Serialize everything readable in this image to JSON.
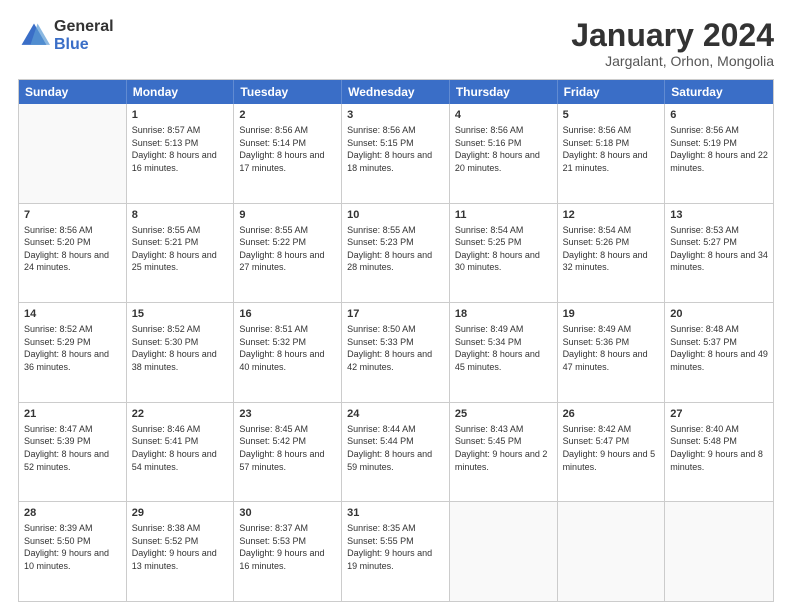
{
  "logo": {
    "general": "General",
    "blue": "Blue"
  },
  "title": "January 2024",
  "subtitle": "Jargalant, Orhon, Mongolia",
  "header_days": [
    "Sunday",
    "Monday",
    "Tuesday",
    "Wednesday",
    "Thursday",
    "Friday",
    "Saturday"
  ],
  "weeks": [
    [
      {
        "day": "",
        "empty": true
      },
      {
        "day": "1",
        "sunrise": "Sunrise: 8:57 AM",
        "sunset": "Sunset: 5:13 PM",
        "daylight": "Daylight: 8 hours and 16 minutes."
      },
      {
        "day": "2",
        "sunrise": "Sunrise: 8:56 AM",
        "sunset": "Sunset: 5:14 PM",
        "daylight": "Daylight: 8 hours and 17 minutes."
      },
      {
        "day": "3",
        "sunrise": "Sunrise: 8:56 AM",
        "sunset": "Sunset: 5:15 PM",
        "daylight": "Daylight: 8 hours and 18 minutes."
      },
      {
        "day": "4",
        "sunrise": "Sunrise: 8:56 AM",
        "sunset": "Sunset: 5:16 PM",
        "daylight": "Daylight: 8 hours and 20 minutes."
      },
      {
        "day": "5",
        "sunrise": "Sunrise: 8:56 AM",
        "sunset": "Sunset: 5:18 PM",
        "daylight": "Daylight: 8 hours and 21 minutes."
      },
      {
        "day": "6",
        "sunrise": "Sunrise: 8:56 AM",
        "sunset": "Sunset: 5:19 PM",
        "daylight": "Daylight: 8 hours and 22 minutes."
      }
    ],
    [
      {
        "day": "7",
        "sunrise": "Sunrise: 8:56 AM",
        "sunset": "Sunset: 5:20 PM",
        "daylight": "Daylight: 8 hours and 24 minutes."
      },
      {
        "day": "8",
        "sunrise": "Sunrise: 8:55 AM",
        "sunset": "Sunset: 5:21 PM",
        "daylight": "Daylight: 8 hours and 25 minutes."
      },
      {
        "day": "9",
        "sunrise": "Sunrise: 8:55 AM",
        "sunset": "Sunset: 5:22 PM",
        "daylight": "Daylight: 8 hours and 27 minutes."
      },
      {
        "day": "10",
        "sunrise": "Sunrise: 8:55 AM",
        "sunset": "Sunset: 5:23 PM",
        "daylight": "Daylight: 8 hours and 28 minutes."
      },
      {
        "day": "11",
        "sunrise": "Sunrise: 8:54 AM",
        "sunset": "Sunset: 5:25 PM",
        "daylight": "Daylight: 8 hours and 30 minutes."
      },
      {
        "day": "12",
        "sunrise": "Sunrise: 8:54 AM",
        "sunset": "Sunset: 5:26 PM",
        "daylight": "Daylight: 8 hours and 32 minutes."
      },
      {
        "day": "13",
        "sunrise": "Sunrise: 8:53 AM",
        "sunset": "Sunset: 5:27 PM",
        "daylight": "Daylight: 8 hours and 34 minutes."
      }
    ],
    [
      {
        "day": "14",
        "sunrise": "Sunrise: 8:52 AM",
        "sunset": "Sunset: 5:29 PM",
        "daylight": "Daylight: 8 hours and 36 minutes."
      },
      {
        "day": "15",
        "sunrise": "Sunrise: 8:52 AM",
        "sunset": "Sunset: 5:30 PM",
        "daylight": "Daylight: 8 hours and 38 minutes."
      },
      {
        "day": "16",
        "sunrise": "Sunrise: 8:51 AM",
        "sunset": "Sunset: 5:32 PM",
        "daylight": "Daylight: 8 hours and 40 minutes."
      },
      {
        "day": "17",
        "sunrise": "Sunrise: 8:50 AM",
        "sunset": "Sunset: 5:33 PM",
        "daylight": "Daylight: 8 hours and 42 minutes."
      },
      {
        "day": "18",
        "sunrise": "Sunrise: 8:49 AM",
        "sunset": "Sunset: 5:34 PM",
        "daylight": "Daylight: 8 hours and 45 minutes."
      },
      {
        "day": "19",
        "sunrise": "Sunrise: 8:49 AM",
        "sunset": "Sunset: 5:36 PM",
        "daylight": "Daylight: 8 hours and 47 minutes."
      },
      {
        "day": "20",
        "sunrise": "Sunrise: 8:48 AM",
        "sunset": "Sunset: 5:37 PM",
        "daylight": "Daylight: 8 hours and 49 minutes."
      }
    ],
    [
      {
        "day": "21",
        "sunrise": "Sunrise: 8:47 AM",
        "sunset": "Sunset: 5:39 PM",
        "daylight": "Daylight: 8 hours and 52 minutes."
      },
      {
        "day": "22",
        "sunrise": "Sunrise: 8:46 AM",
        "sunset": "Sunset: 5:41 PM",
        "daylight": "Daylight: 8 hours and 54 minutes."
      },
      {
        "day": "23",
        "sunrise": "Sunrise: 8:45 AM",
        "sunset": "Sunset: 5:42 PM",
        "daylight": "Daylight: 8 hours and 57 minutes."
      },
      {
        "day": "24",
        "sunrise": "Sunrise: 8:44 AM",
        "sunset": "Sunset: 5:44 PM",
        "daylight": "Daylight: 8 hours and 59 minutes."
      },
      {
        "day": "25",
        "sunrise": "Sunrise: 8:43 AM",
        "sunset": "Sunset: 5:45 PM",
        "daylight": "Daylight: 9 hours and 2 minutes."
      },
      {
        "day": "26",
        "sunrise": "Sunrise: 8:42 AM",
        "sunset": "Sunset: 5:47 PM",
        "daylight": "Daylight: 9 hours and 5 minutes."
      },
      {
        "day": "27",
        "sunrise": "Sunrise: 8:40 AM",
        "sunset": "Sunset: 5:48 PM",
        "daylight": "Daylight: 9 hours and 8 minutes."
      }
    ],
    [
      {
        "day": "28",
        "sunrise": "Sunrise: 8:39 AM",
        "sunset": "Sunset: 5:50 PM",
        "daylight": "Daylight: 9 hours and 10 minutes."
      },
      {
        "day": "29",
        "sunrise": "Sunrise: 8:38 AM",
        "sunset": "Sunset: 5:52 PM",
        "daylight": "Daylight: 9 hours and 13 minutes."
      },
      {
        "day": "30",
        "sunrise": "Sunrise: 8:37 AM",
        "sunset": "Sunset: 5:53 PM",
        "daylight": "Daylight: 9 hours and 16 minutes."
      },
      {
        "day": "31",
        "sunrise": "Sunrise: 8:35 AM",
        "sunset": "Sunset: 5:55 PM",
        "daylight": "Daylight: 9 hours and 19 minutes."
      },
      {
        "day": "",
        "empty": true
      },
      {
        "day": "",
        "empty": true
      },
      {
        "day": "",
        "empty": true
      }
    ]
  ]
}
